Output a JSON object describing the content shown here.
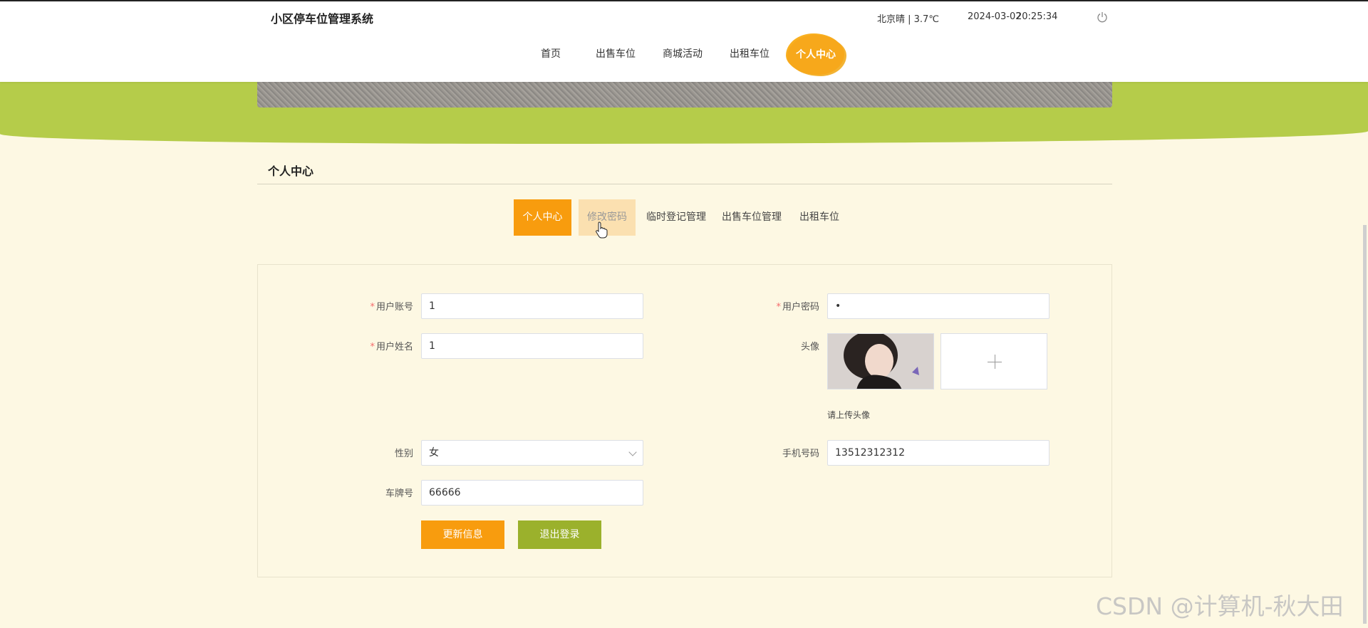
{
  "header": {
    "site_title": "小区停车位管理系统",
    "weather": "北京晴 | 3.7℃",
    "date": "2024-03-02",
    "time": "20:25:34",
    "power_icon": "power-icon"
  },
  "nav": {
    "items": [
      {
        "label": "首页"
      },
      {
        "label": "出售车位"
      },
      {
        "label": "商城活动"
      },
      {
        "label": "出租车位"
      },
      {
        "label": "个人中心",
        "active": true
      }
    ]
  },
  "section": {
    "title": "个人中心"
  },
  "tabs": {
    "items": [
      {
        "label": "个人中心",
        "state": "active"
      },
      {
        "label": "修改密码",
        "state": "hover"
      },
      {
        "label": "临时登记管理"
      },
      {
        "label": "出售车位管理"
      },
      {
        "label": "出租车位"
      }
    ]
  },
  "form": {
    "account_label": "用户账号",
    "account_value": "1",
    "password_label": "用户密码",
    "password_value": "•",
    "name_label": "用户姓名",
    "name_value": "1",
    "avatar_label": "头像",
    "avatar_hint": "请上传头像",
    "gender_label": "性别",
    "gender_value": "女",
    "phone_label": "手机号码",
    "phone_value": "13512312312",
    "plate_label": "车牌号",
    "plate_value": "66666",
    "required_mark": "*",
    "update_button": "更新信息",
    "logout_button": "退出登录"
  },
  "watermark": "CSDN @计算机-秋大田",
  "colors": {
    "accent_orange": "#f89c0e",
    "accent_green": "#9bb12c",
    "banner_green": "#b5cc4a",
    "background": "#fdf8e3"
  }
}
